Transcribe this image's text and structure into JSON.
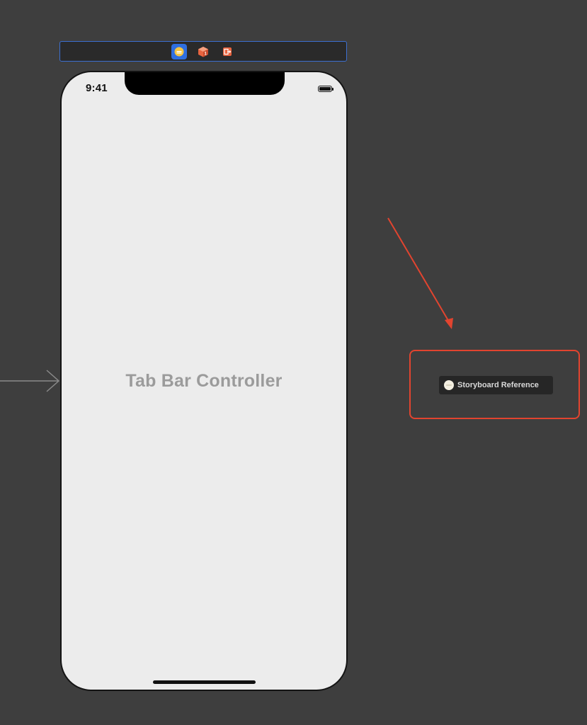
{
  "canvas": {
    "background": "#3e3e3e"
  },
  "scene_dock": {
    "items": [
      {
        "name": "view-controller-icon",
        "selected": true
      },
      {
        "name": "first-responder-icon",
        "selected": false
      },
      {
        "name": "exit-icon",
        "selected": false
      }
    ],
    "accent": "#3c6fd1"
  },
  "phone": {
    "status_time": "9:41",
    "scene_title": "Tab Bar Controller"
  },
  "storyboard_reference": {
    "label": "Storyboard Reference",
    "icon": "storyboard-reference-icon"
  },
  "annotation": {
    "color": "#e2442f"
  }
}
